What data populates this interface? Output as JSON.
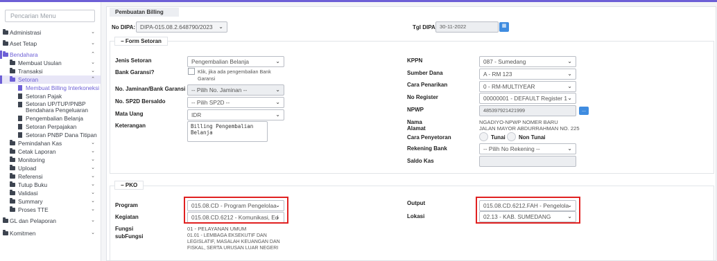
{
  "sidebar": {
    "search_placeholder": "Pencarian Menu",
    "items": [
      {
        "label": "Administrasi"
      },
      {
        "label": "Aset Tetap"
      },
      {
        "label": "Bendahara"
      },
      {
        "label": "Membuat Usulan"
      },
      {
        "label": "Transaksi"
      },
      {
        "label": "Setoran"
      },
      {
        "label": "Membuat Billing Interkoneksi"
      },
      {
        "label": "Setoran Pajak"
      },
      {
        "label": "Setoran UP/TUP/PNBP Bendahara Pengeluaran"
      },
      {
        "label": "Pengembalian Belanja"
      },
      {
        "label": "Setoran Perpajakan"
      },
      {
        "label": "Setoran PNBP Dana Titipan"
      },
      {
        "label": "Pemindahan Kas"
      },
      {
        "label": "Cetak Laporan"
      },
      {
        "label": "Monitoring"
      },
      {
        "label": "Upload"
      },
      {
        "label": "Referensi"
      },
      {
        "label": "Tutup Buku"
      },
      {
        "label": "Validasi"
      },
      {
        "label": "Summary"
      },
      {
        "label": "Proses TTE"
      },
      {
        "label": "GL dan Pelaporan"
      },
      {
        "label": "Komitmen"
      }
    ]
  },
  "header": {
    "card_title": "Pembuatan Billing",
    "no_dipa_label": "No DIPA:",
    "no_dipa_value": "DIPA-015.08.2.648790/2023",
    "tgl_dipa_label": "Tgl DIPA:",
    "tgl_dipa_value": "30-11-2022"
  },
  "form_setoran": {
    "legend": "Form Setoran",
    "jenis_setoran_label": "Jenis Setoran",
    "jenis_setoran_value": "Pengembalian Belanja",
    "bank_garansi_label": "Bank Garansi?",
    "bank_garansi_text": "Klik, jika ada pengembalian Bank Garansi",
    "no_jaminan_label": "No. Jaminan/Bank Garansi",
    "no_jaminan_value": "-- Pilih No. Jaminan --",
    "no_sp2d_label": "No. SP2D Bersaldo",
    "no_sp2d_value": "-- Pilih SP2D --",
    "mata_uang_label": "Mata Uang",
    "mata_uang_value": "IDR",
    "keterangan_label": "Keterangan",
    "keterangan_value": "Billing Pengembalian Belanja",
    "kppn_label": "KPPN",
    "kppn_value": "087 - Sumedang",
    "sumber_dana_label": "Sumber Dana",
    "sumber_dana_value": "A - RM 123",
    "cara_penarikan_label": "Cara Penarikan",
    "cara_penarikan_value": "0 - RM-MULTIYEAR",
    "no_register_label": "No Register",
    "no_register_value": "00000001 - DEFAULT Register 1",
    "npwp_label": "NPWP",
    "npwp_value": "485397921421999",
    "npwp_button": "...",
    "nama_label": "Nama",
    "nama_value": "NGADIYO-NPWP NOMER BARU",
    "alamat_label": "Alamat",
    "alamat_value": "JALAN MAYOR ABDURRAHMAN NO. 225",
    "cara_penyetoran_label": "Cara Penyetoran",
    "tunai_label": "Tunai",
    "non_tunai_label": "Non Tunai",
    "rekening_bank_label": "Rekening Bank",
    "rekening_bank_value": "-- Pilih No Rekening --",
    "saldo_kas_label": "Saldo Kas"
  },
  "pko": {
    "legend": "PKO",
    "program_label": "Program",
    "program_value": "015.08.CD - Program Pengelolaa",
    "kegiatan_label": "Kegiatan",
    "kegiatan_value": "015.08.CD.6212 - Komunikasi, Ed",
    "fungsi_label": "Fungsi",
    "fungsi_value": "01 - PELAYANAN UMUM",
    "subfungsi_label": "subFungsi",
    "subfungsi_value": "01.01 - LEMBAGA EKSEKUTIF DAN LEGISLATIF, MASALAH KEUANGAN DAN FISKAL, SERTA URUSAN LUAR NEGERI",
    "output_label": "Output",
    "output_value": "015.08.CD.6212.FAH - Pengelola",
    "lokasi_label": "Lokasi",
    "lokasi_value": "02.13 - KAB. SUMEDANG"
  },
  "colors": {
    "accent": "#6d5fd6",
    "highlight": "#e02020",
    "button": "#3f8ce0"
  }
}
